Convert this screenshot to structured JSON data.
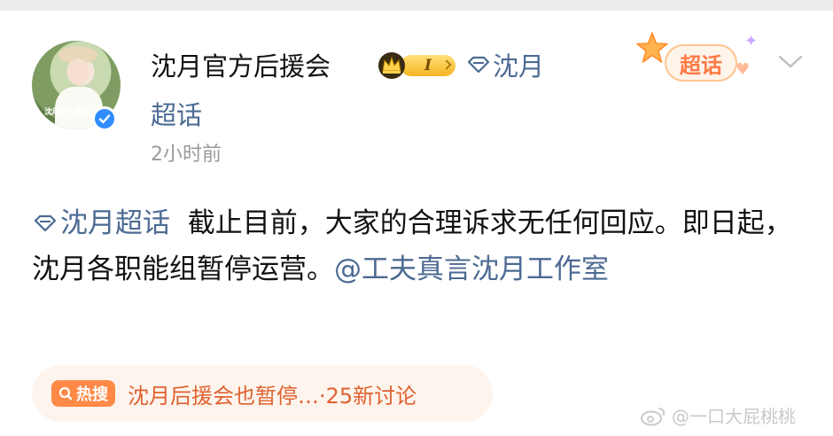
{
  "post": {
    "author": {
      "name": "沈月官方后援会",
      "avatar_text": "沈月个人信息",
      "badge_level": "I",
      "topic_tag": "沈月",
      "topic_tag_suffix": "超话"
    },
    "timestamp": "2小时前",
    "chaohua_button": "超话",
    "content": {
      "tag": "沈月超话",
      "body": "截止目前，大家的合理诉求无任何回应。即日起，沈月各职能组暂停运营。",
      "mention": "@工夫真言沈月工作室"
    },
    "hot_search": {
      "badge": "热搜",
      "text": "沈月后援会也暂停…·25新讨论"
    },
    "watermark": "@一口大屁桃桃"
  },
  "colors": {
    "link": "#4c6a92",
    "hot": "#ff8a47",
    "verified": "#2f8dff"
  }
}
